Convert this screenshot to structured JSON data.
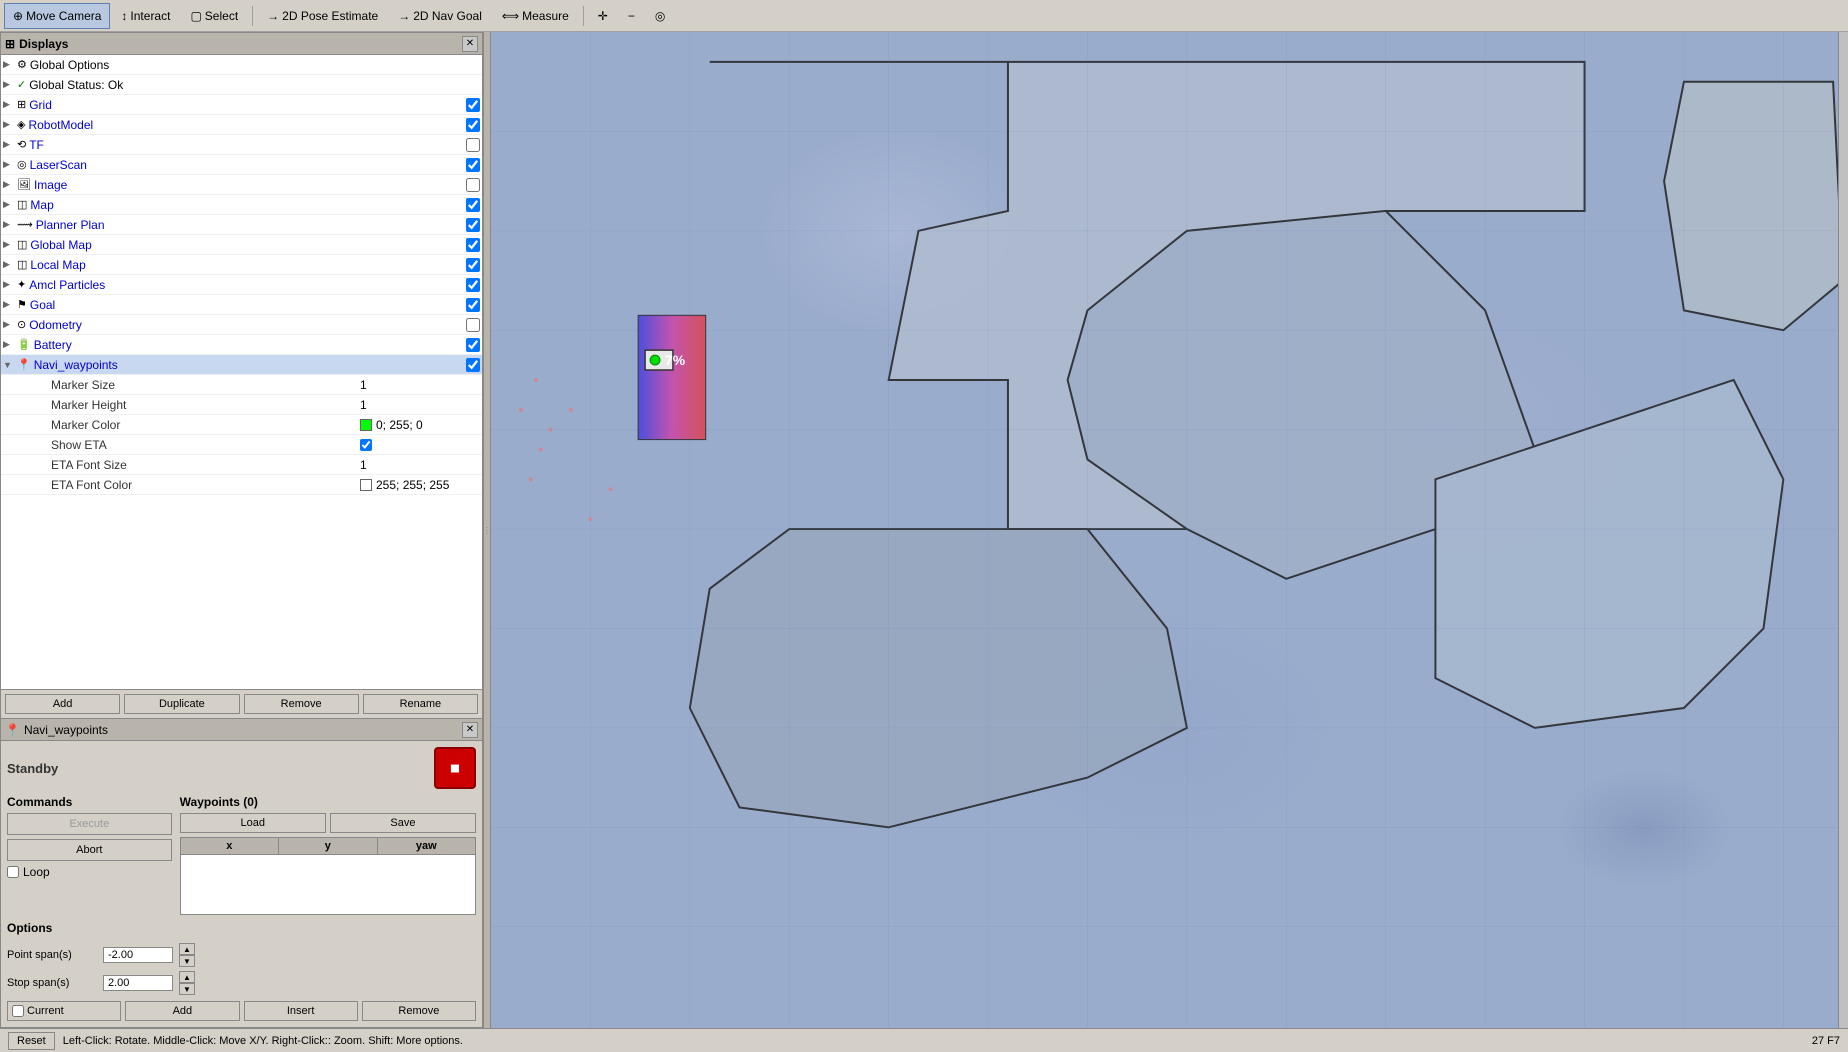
{
  "toolbar": {
    "buttons": [
      {
        "id": "move-camera",
        "label": "Move Camera",
        "icon": "⊕",
        "active": true
      },
      {
        "id": "interact",
        "label": "Interact",
        "icon": "↕"
      },
      {
        "id": "select",
        "label": "Select",
        "icon": "▢"
      },
      {
        "id": "pose-estimate",
        "label": "2D Pose Estimate",
        "icon": "→"
      },
      {
        "id": "nav-goal",
        "label": "2D Nav Goal",
        "icon": "→"
      },
      {
        "id": "measure",
        "label": "Measure",
        "icon": "⟺"
      }
    ],
    "extra_icons": [
      "✛",
      "−",
      "◎"
    ]
  },
  "displays_panel": {
    "title": "Displays",
    "items": [
      {
        "id": "global-options",
        "name": "Global Options",
        "icon": "⚙",
        "level": 0,
        "has_arrow": true,
        "checkable": false
      },
      {
        "id": "global-status",
        "name": "Global Status: Ok",
        "icon": "✓",
        "level": 0,
        "has_arrow": true,
        "checkable": false
      },
      {
        "id": "grid",
        "name": "Grid",
        "icon": "⊞",
        "level": 0,
        "has_arrow": true,
        "checkable": true,
        "checked": true
      },
      {
        "id": "robot-model",
        "name": "RobotModel",
        "icon": "🤖",
        "level": 0,
        "has_arrow": true,
        "checkable": true,
        "checked": true
      },
      {
        "id": "tf",
        "name": "TF",
        "icon": "🔀",
        "level": 0,
        "has_arrow": true,
        "checkable": true,
        "checked": false
      },
      {
        "id": "laser-scan",
        "name": "LaserScan",
        "icon": "◎",
        "level": 0,
        "has_arrow": true,
        "checkable": true,
        "checked": true
      },
      {
        "id": "image",
        "name": "Image",
        "icon": "🖼",
        "level": 0,
        "has_arrow": true,
        "checkable": true,
        "checked": false
      },
      {
        "id": "map",
        "name": "Map",
        "icon": "🗺",
        "level": 0,
        "has_arrow": true,
        "checkable": true,
        "checked": true
      },
      {
        "id": "planner-plan",
        "name": "Planner Plan",
        "icon": "📐",
        "level": 0,
        "has_arrow": true,
        "checkable": true,
        "checked": true
      },
      {
        "id": "global-map",
        "name": "Global Map",
        "icon": "🗺",
        "level": 0,
        "has_arrow": true,
        "checkable": true,
        "checked": true
      },
      {
        "id": "local-map",
        "name": "Local Map",
        "icon": "🗺",
        "level": 0,
        "has_arrow": true,
        "checkable": true,
        "checked": true
      },
      {
        "id": "amcl-particles",
        "name": "Amcl Particles",
        "icon": "✦",
        "level": 0,
        "has_arrow": true,
        "checkable": true,
        "checked": true
      },
      {
        "id": "goal",
        "name": "Goal",
        "icon": "⚑",
        "level": 0,
        "has_arrow": true,
        "checkable": true,
        "checked": true
      },
      {
        "id": "odometry",
        "name": "Odometry",
        "icon": "⊙",
        "level": 0,
        "has_arrow": true,
        "checkable": true,
        "checked": false
      },
      {
        "id": "battery",
        "name": "Battery",
        "icon": "🔋",
        "level": 0,
        "has_arrow": true,
        "checkable": true,
        "checked": true
      },
      {
        "id": "navi-waypoints",
        "name": "Navi_waypoints",
        "icon": "📍",
        "level": 0,
        "has_arrow": true,
        "checkable": true,
        "checked": true,
        "expanded": true
      }
    ],
    "sub_items": [
      {
        "label": "Marker Size",
        "value": "1"
      },
      {
        "label": "Marker Height",
        "value": "1"
      },
      {
        "label": "Marker Color",
        "value": "0; 255; 0",
        "color": "#00ff00"
      },
      {
        "label": "Show ETA",
        "value": "",
        "checkbox": true,
        "checked": true
      },
      {
        "label": "ETA Font Size",
        "value": "1"
      },
      {
        "label": "ETA Font Color",
        "value": "255; 255; 255",
        "color": "#ffffff"
      }
    ],
    "footer_buttons": [
      "Add",
      "Duplicate",
      "Remove",
      "Rename"
    ]
  },
  "navi_panel": {
    "title": "Navi_waypoints",
    "standby_label": "Standby",
    "commands_label": "Commands",
    "execute_label": "Execute",
    "abort_label": "Abort",
    "loop_label": "Loop",
    "waypoints_label": "Waypoints (0)",
    "load_label": "Load",
    "save_label": "Save",
    "table_cols": [
      "x",
      "y",
      "yaw"
    ],
    "options_label": "Options",
    "point_span_label": "Point span(s)",
    "point_span_value": "-2.00",
    "stop_span_label": "Stop span(s)",
    "stop_span_value": "2.00",
    "current_label": "Current",
    "add_wp_label": "Add",
    "insert_label": "Insert",
    "remove_wp_label": "Remove"
  },
  "status_bar": {
    "reset_label": "Reset",
    "help_text": "Left-Click: Rotate.  Middle-Click: Move X/Y.  Right-Click:: Zoom.  Shift: More options.",
    "coords": "27 F7"
  },
  "map": {
    "background_color": "#9aaccc"
  }
}
